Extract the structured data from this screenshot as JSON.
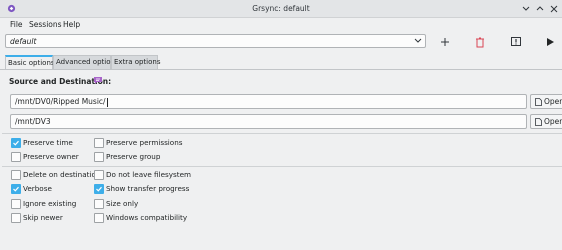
{
  "window": {
    "title": "Grsync: default",
    "controls": [
      "chevron-down-icon",
      "chevron-up-icon",
      "close-icon"
    ]
  },
  "menu": [
    "File",
    "Sessions",
    "Help"
  ],
  "session": {
    "value": "default"
  },
  "toolbar": {
    "icons": [
      "add-session-icon",
      "delete-session-icon",
      "simulate-icon",
      "execute-icon"
    ]
  },
  "tabs": [
    {
      "label": "Basic options",
      "active": true
    },
    {
      "label": "Advanced options",
      "active": false
    },
    {
      "label": "Extra options",
      "active": false
    }
  ],
  "source_dest": {
    "label": "Source and Destination:",
    "source": "/mnt/DV0/Ripped Music/",
    "destination": "/mnt/DV3",
    "open_label": "Open"
  },
  "options": {
    "preserve_time": {
      "label": "Preserve time",
      "checked": true
    },
    "preserve_permissions": {
      "label": "Preserve permissions",
      "checked": false
    },
    "preserve_owner": {
      "label": "Preserve owner",
      "checked": false
    },
    "preserve_group": {
      "label": "Preserve group",
      "checked": false
    },
    "delete_on_destination": {
      "label": "Delete on destination",
      "checked": false
    },
    "do_not_leave_filesystem": {
      "label": "Do not leave filesystem",
      "checked": false
    },
    "verbose": {
      "label": "Verbose",
      "checked": true
    },
    "show_transfer_progress": {
      "label": "Show transfer progress",
      "checked": true
    },
    "ignore_existing": {
      "label": "Ignore existing",
      "checked": false
    },
    "size_only": {
      "label": "Size only",
      "checked": false
    },
    "skip_newer": {
      "label": "Skip newer",
      "checked": false
    },
    "windows_compatibility": {
      "label": "Windows compatibility",
      "checked": false
    }
  },
  "colors": {
    "accent": "#3daee9",
    "background": "#eff0f1",
    "info_icon": "#a865c9"
  }
}
